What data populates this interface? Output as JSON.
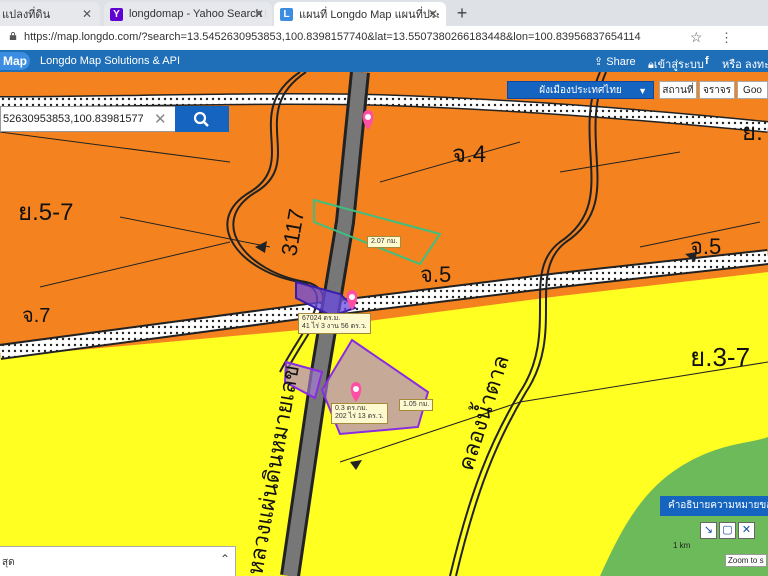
{
  "browser": {
    "tabs": [
      {
        "title": "แปลงที่ดิน",
        "active": false
      },
      {
        "title": "longdomap - Yahoo Search Resu",
        "active": false
      },
      {
        "title": "แผนที่ Longdo Map แผนที่ประเทศไ",
        "active": true
      }
    ],
    "new_tab": "+",
    "url": "https://map.longdo.com/?search=13.5452630953853,100.8398157740&lat=13.5507380266183448&lon=100.83956837654114"
  },
  "longdo": {
    "logo": "Map",
    "brand": "Longdo Map Solutions & API",
    "share": "Share",
    "login": "เข้าสู่ระบบ",
    "fb": "f",
    "or": "หรือ ลงทะเบ"
  },
  "map_ui": {
    "layer_select": "ผังเมืองประเทศไทย",
    "type_buttons": [
      "สถานที่",
      "จราจร",
      "Goo"
    ],
    "search_value": "52630953853,100.83981577",
    "clear": "✕"
  },
  "map_labels": {
    "zones": [
      "ย.5-7",
      "จ.4",
      "ย.",
      "จ.5",
      "จ.5",
      "จ.7",
      "ย.3-7"
    ],
    "road_number": "3117",
    "road_name": "หลวงแผ่นดินหมายเลข",
    "canal_name": "คลองน้ำตาล"
  },
  "measurements": {
    "distance_1": "2.07 กม.",
    "area_1_line1": "67024 ตร.ม.",
    "area_1_line2": "41 ไร่ 3 งาน 56 ตร.ว.",
    "area_2_line1": "0.3 ตร.กม.",
    "area_2_line2": "202 ไร่ 13 ตร.ว.",
    "distance_2": "1.05 กม."
  },
  "bottom": {
    "legend_button": "คำอธิบายความหมายของ",
    "tools": [
      "↘",
      "▢",
      "✕"
    ],
    "scale": "1 km",
    "zoom_tip": "Zoom to s",
    "panel_text": "สุด",
    "panel_chevron": "⌃"
  },
  "colors": {
    "orange_zone": "#f4831f",
    "yellow_zone": "#ffff22",
    "green_zone": "#6cba5a",
    "header_blue": "#1f6fb8",
    "button_blue": "#1565c0",
    "measure_purple": "#8a2be2",
    "measure_green": "#3fbf7f"
  }
}
